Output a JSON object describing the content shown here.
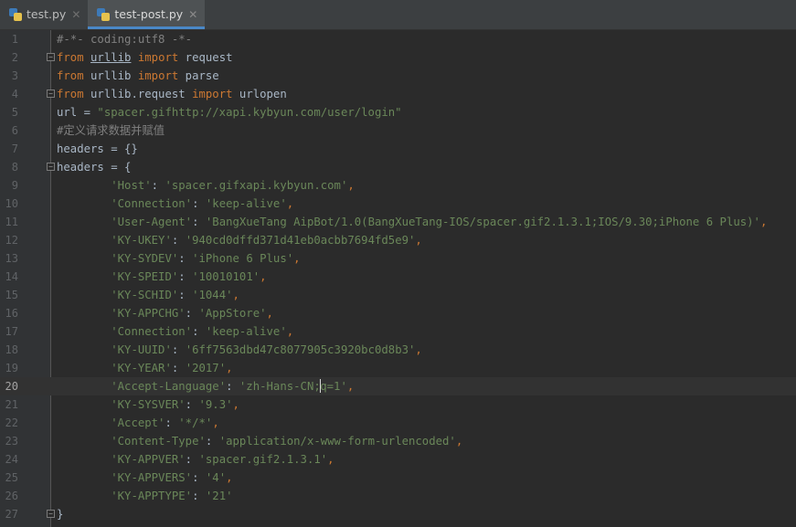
{
  "tabs": [
    {
      "label": "test.py",
      "icon": "python-file-icon",
      "active": false
    },
    {
      "label": "test-post.py",
      "icon": "python-file-icon",
      "active": true
    }
  ],
  "editor": {
    "current_line": 20,
    "colors": {
      "keyword": "#cc7832",
      "string": "#6a8759",
      "comment": "#808080",
      "text": "#a9b7c6",
      "background": "#2b2b2b"
    },
    "lines": [
      {
        "n": "1",
        "fold": false,
        "tokens": [
          {
            "t": "cmt",
            "v": "#-*- coding:utf8 -*-"
          }
        ]
      },
      {
        "n": "2",
        "fold": true,
        "tokens": [
          {
            "t": "kw",
            "v": "from"
          },
          {
            "t": "plain",
            "v": " "
          },
          {
            "t": "link",
            "v": "urllib"
          },
          {
            "t": "plain",
            "v": " "
          },
          {
            "t": "kw",
            "v": "import"
          },
          {
            "t": "plain",
            "v": " request"
          }
        ]
      },
      {
        "n": "3",
        "fold": false,
        "tokens": [
          {
            "t": "kw",
            "v": "from"
          },
          {
            "t": "plain",
            "v": " urllib "
          },
          {
            "t": "kw",
            "v": "import"
          },
          {
            "t": "plain",
            "v": " parse"
          }
        ]
      },
      {
        "n": "4",
        "fold": true,
        "tokens": [
          {
            "t": "kw",
            "v": "from"
          },
          {
            "t": "plain",
            "v": " urllib.request "
          },
          {
            "t": "kw",
            "v": "import"
          },
          {
            "t": "plain",
            "v": " urlopen"
          }
        ]
      },
      {
        "n": "5",
        "fold": false,
        "tokens": [
          {
            "t": "plain",
            "v": "url = "
          },
          {
            "t": "str",
            "v": "\"spacer.gifhttp://xapi.kybyun.com/user/login\""
          }
        ]
      },
      {
        "n": "6",
        "fold": false,
        "tokens": [
          {
            "t": "cmt",
            "v": "#定义请求数据并赋值"
          }
        ]
      },
      {
        "n": "7",
        "fold": false,
        "tokens": [
          {
            "t": "plain",
            "v": "headers = {}"
          }
        ]
      },
      {
        "n": "8",
        "fold": true,
        "tokens": [
          {
            "t": "plain",
            "v": "headers = {"
          }
        ]
      },
      {
        "n": "9",
        "fold": false,
        "tokens": [
          {
            "t": "plain",
            "v": "        "
          },
          {
            "t": "str",
            "v": "'Host'"
          },
          {
            "t": "plain",
            "v": ": "
          },
          {
            "t": "str",
            "v": "'spacer.gifxapi.kybyun.com'"
          },
          {
            "t": "kw",
            "v": ","
          }
        ]
      },
      {
        "n": "10",
        "fold": false,
        "tokens": [
          {
            "t": "plain",
            "v": "        "
          },
          {
            "t": "str",
            "v": "'Connection'"
          },
          {
            "t": "plain",
            "v": ": "
          },
          {
            "t": "str",
            "v": "'keep-alive'"
          },
          {
            "t": "kw",
            "v": ","
          }
        ]
      },
      {
        "n": "11",
        "fold": false,
        "tokens": [
          {
            "t": "plain",
            "v": "        "
          },
          {
            "t": "str",
            "v": "'User-Agent'"
          },
          {
            "t": "plain",
            "v": ": "
          },
          {
            "t": "str",
            "v": "'BangXueTang AipBot/1.0(BangXueTang-IOS/spacer.gif2.1.3.1;IOS/9.30;iPhone 6 Plus)'"
          },
          {
            "t": "kw",
            "v": ","
          }
        ]
      },
      {
        "n": "12",
        "fold": false,
        "tokens": [
          {
            "t": "plain",
            "v": "        "
          },
          {
            "t": "str",
            "v": "'KY-UKEY'"
          },
          {
            "t": "plain",
            "v": ": "
          },
          {
            "t": "str",
            "v": "'940cd0dffd371d41eb0acbb7694fd5e9'"
          },
          {
            "t": "kw",
            "v": ","
          }
        ]
      },
      {
        "n": "13",
        "fold": false,
        "tokens": [
          {
            "t": "plain",
            "v": "        "
          },
          {
            "t": "str",
            "v": "'KY-SYDEV'"
          },
          {
            "t": "plain",
            "v": ": "
          },
          {
            "t": "str",
            "v": "'iPhone 6 Plus'"
          },
          {
            "t": "kw",
            "v": ","
          }
        ]
      },
      {
        "n": "14",
        "fold": false,
        "tokens": [
          {
            "t": "plain",
            "v": "        "
          },
          {
            "t": "str",
            "v": "'KY-SPEID'"
          },
          {
            "t": "plain",
            "v": ": "
          },
          {
            "t": "str",
            "v": "'10010101'"
          },
          {
            "t": "kw",
            "v": ","
          }
        ]
      },
      {
        "n": "15",
        "fold": false,
        "tokens": [
          {
            "t": "plain",
            "v": "        "
          },
          {
            "t": "str",
            "v": "'KY-SCHID'"
          },
          {
            "t": "plain",
            "v": ": "
          },
          {
            "t": "str",
            "v": "'1044'"
          },
          {
            "t": "kw",
            "v": ","
          }
        ]
      },
      {
        "n": "16",
        "fold": false,
        "tokens": [
          {
            "t": "plain",
            "v": "        "
          },
          {
            "t": "str",
            "v": "'KY-APPCHG'"
          },
          {
            "t": "plain",
            "v": ": "
          },
          {
            "t": "str",
            "v": "'AppStore'"
          },
          {
            "t": "kw",
            "v": ","
          }
        ]
      },
      {
        "n": "17",
        "fold": false,
        "tokens": [
          {
            "t": "plain",
            "v": "        "
          },
          {
            "t": "str",
            "v": "'Connection'"
          },
          {
            "t": "plain",
            "v": ": "
          },
          {
            "t": "str",
            "v": "'keep-alive'"
          },
          {
            "t": "kw",
            "v": ","
          }
        ]
      },
      {
        "n": "18",
        "fold": false,
        "tokens": [
          {
            "t": "plain",
            "v": "        "
          },
          {
            "t": "str",
            "v": "'KY-UUID'"
          },
          {
            "t": "plain",
            "v": ": "
          },
          {
            "t": "str",
            "v": "'6ff7563dbd47c8077905c3920bc0d8b3'"
          },
          {
            "t": "kw",
            "v": ","
          }
        ]
      },
      {
        "n": "19",
        "fold": false,
        "tokens": [
          {
            "t": "plain",
            "v": "        "
          },
          {
            "t": "str",
            "v": "'KY-YEAR'"
          },
          {
            "t": "plain",
            "v": ": "
          },
          {
            "t": "str",
            "v": "'2017'"
          },
          {
            "t": "kw",
            "v": ","
          }
        ]
      },
      {
        "n": "20",
        "fold": false,
        "tokens": [
          {
            "t": "plain",
            "v": "        "
          },
          {
            "t": "str",
            "v": "'Accept-Language'"
          },
          {
            "t": "plain",
            "v": ": "
          },
          {
            "t": "str",
            "v": "'zh-Hans-CN;"
          },
          {
            "t": "caret",
            "v": ""
          },
          {
            "t": "str",
            "v": "q=1'"
          },
          {
            "t": "kw",
            "v": ","
          }
        ]
      },
      {
        "n": "21",
        "fold": false,
        "tokens": [
          {
            "t": "plain",
            "v": "        "
          },
          {
            "t": "str",
            "v": "'KY-SYSVER'"
          },
          {
            "t": "plain",
            "v": ": "
          },
          {
            "t": "str",
            "v": "'9.3'"
          },
          {
            "t": "kw",
            "v": ","
          }
        ]
      },
      {
        "n": "22",
        "fold": false,
        "tokens": [
          {
            "t": "plain",
            "v": "        "
          },
          {
            "t": "str",
            "v": "'Accept'"
          },
          {
            "t": "plain",
            "v": ": "
          },
          {
            "t": "str",
            "v": "'*/*'"
          },
          {
            "t": "kw",
            "v": ","
          }
        ]
      },
      {
        "n": "23",
        "fold": false,
        "tokens": [
          {
            "t": "plain",
            "v": "        "
          },
          {
            "t": "str",
            "v": "'Content-Type'"
          },
          {
            "t": "plain",
            "v": ": "
          },
          {
            "t": "str",
            "v": "'application/x-www-form-urlencoded'"
          },
          {
            "t": "kw",
            "v": ","
          }
        ]
      },
      {
        "n": "24",
        "fold": false,
        "tokens": [
          {
            "t": "plain",
            "v": "        "
          },
          {
            "t": "str",
            "v": "'KY-APPVER'"
          },
          {
            "t": "plain",
            "v": ": "
          },
          {
            "t": "str",
            "v": "'spacer.gif2.1.3.1'"
          },
          {
            "t": "kw",
            "v": ","
          }
        ]
      },
      {
        "n": "25",
        "fold": false,
        "tokens": [
          {
            "t": "plain",
            "v": "        "
          },
          {
            "t": "str",
            "v": "'KY-APPVERS'"
          },
          {
            "t": "plain",
            "v": ": "
          },
          {
            "t": "str",
            "v": "'4'"
          },
          {
            "t": "kw",
            "v": ","
          }
        ]
      },
      {
        "n": "26",
        "fold": false,
        "tokens": [
          {
            "t": "plain",
            "v": "        "
          },
          {
            "t": "str",
            "v": "'KY-APPTYPE'"
          },
          {
            "t": "plain",
            "v": ": "
          },
          {
            "t": "str",
            "v": "'21'"
          }
        ]
      },
      {
        "n": "27",
        "fold": true,
        "tokens": [
          {
            "t": "plain",
            "v": "}"
          }
        ]
      }
    ]
  }
}
